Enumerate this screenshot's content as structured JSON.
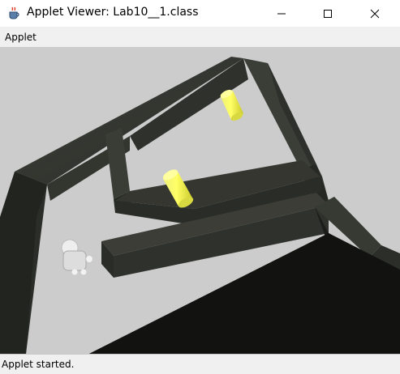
{
  "window": {
    "title": "Applet Viewer: Lab10__1.class"
  },
  "menu": {
    "items": [
      "Applet"
    ]
  },
  "status": {
    "text": "Applet started."
  },
  "scene": {
    "background_color": "#cccccc",
    "wall_color": "#2f322c",
    "collectible_color": "#f2f23a",
    "player_color": "#e6e6e6"
  }
}
